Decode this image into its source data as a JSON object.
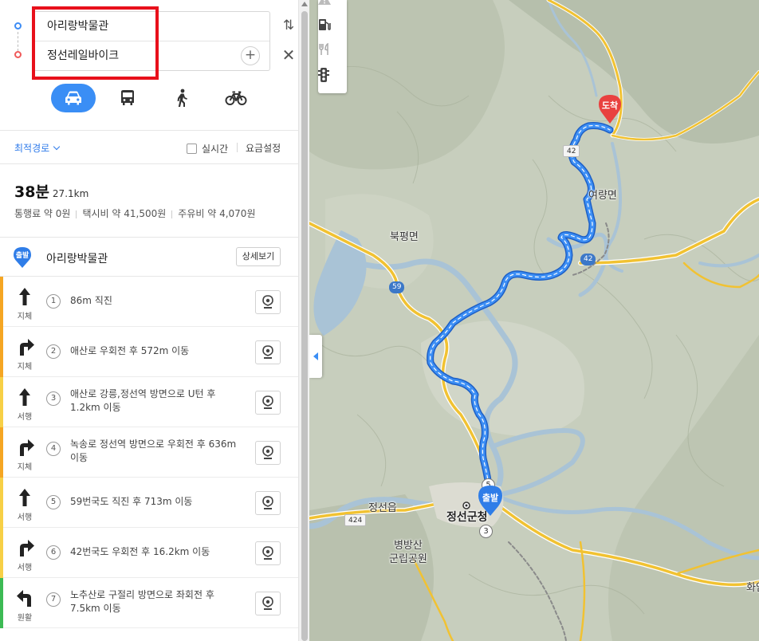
{
  "route_inputs": {
    "origin": "아리랑박물관",
    "destination": "정선레일바이크",
    "add_symbol": "+",
    "swap_symbol": "⇅",
    "close_symbol": "✕"
  },
  "transport_modes": [
    {
      "name": "car",
      "icon": "car-icon",
      "active": true
    },
    {
      "name": "bus",
      "icon": "bus-icon",
      "active": false
    },
    {
      "name": "walk",
      "icon": "walk-icon",
      "active": false
    },
    {
      "name": "bike",
      "icon": "bike-icon",
      "active": false
    }
  ],
  "options": {
    "route_type": "최적경로",
    "realtime_label": "실시간",
    "fee_settings": "요금설정"
  },
  "summary": {
    "time": "38분",
    "distance": "27.1km",
    "toll": "통행료 약 0원",
    "taxi": "택시비 약 41,500원",
    "fuel": "주유비 약 4,070원"
  },
  "start": {
    "pin_label": "출발",
    "name": "아리랑박물관",
    "detail_button": "상세보기"
  },
  "steps": [
    {
      "num": "1",
      "direction": "straight",
      "traffic": "지체",
      "color": "#f5a623",
      "text": "86m 직진"
    },
    {
      "num": "2",
      "direction": "right",
      "traffic": "지체",
      "color": "#f5a623",
      "text": "애산로 우회전 후 572m 이동"
    },
    {
      "num": "3",
      "direction": "straight",
      "traffic": "서행",
      "color": "#f7d046",
      "text": "애산로 강릉,정선역 방면으로 U턴 후 1.2km 이동"
    },
    {
      "num": "4",
      "direction": "right",
      "traffic": "지체",
      "color": "#f5a623",
      "text": "녹송로 정선역 방면으로 우회전 후 636m 이동"
    },
    {
      "num": "5",
      "direction": "straight",
      "traffic": "서행",
      "color": "#f7d046",
      "text": "59번국도 직진 후 713m 이동"
    },
    {
      "num": "6",
      "direction": "right",
      "traffic": "서행",
      "color": "#f7d046",
      "text": "42번국도 우회전 후 16.2km 이동"
    },
    {
      "num": "7",
      "direction": "left",
      "traffic": "원활",
      "color": "#3cba54",
      "text": "노추산로 구절리 방면으로 좌회전 후 7.5km 이동"
    }
  ],
  "map": {
    "labels": {
      "buk_pyeong": "북평면",
      "yeoryang": "여량면",
      "jeongseon_eup": "정선읍",
      "county_office": "정선군청",
      "park": "병방산\n군립공원",
      "edge": "화암"
    },
    "road_badges": {
      "r59": "59",
      "r42": "42",
      "r424": "424",
      "r42_top": "42"
    },
    "end_pin": "도착",
    "start_pin": "출발",
    "waypoints": [
      "5",
      "3"
    ],
    "tools": [
      "warning-icon",
      "fuel-icon",
      "restaurant-icon",
      "traffic-light-icon"
    ],
    "colors": {
      "route": "#2f7de8",
      "highway": "#f1c232",
      "water": "#a9c3d6"
    }
  }
}
